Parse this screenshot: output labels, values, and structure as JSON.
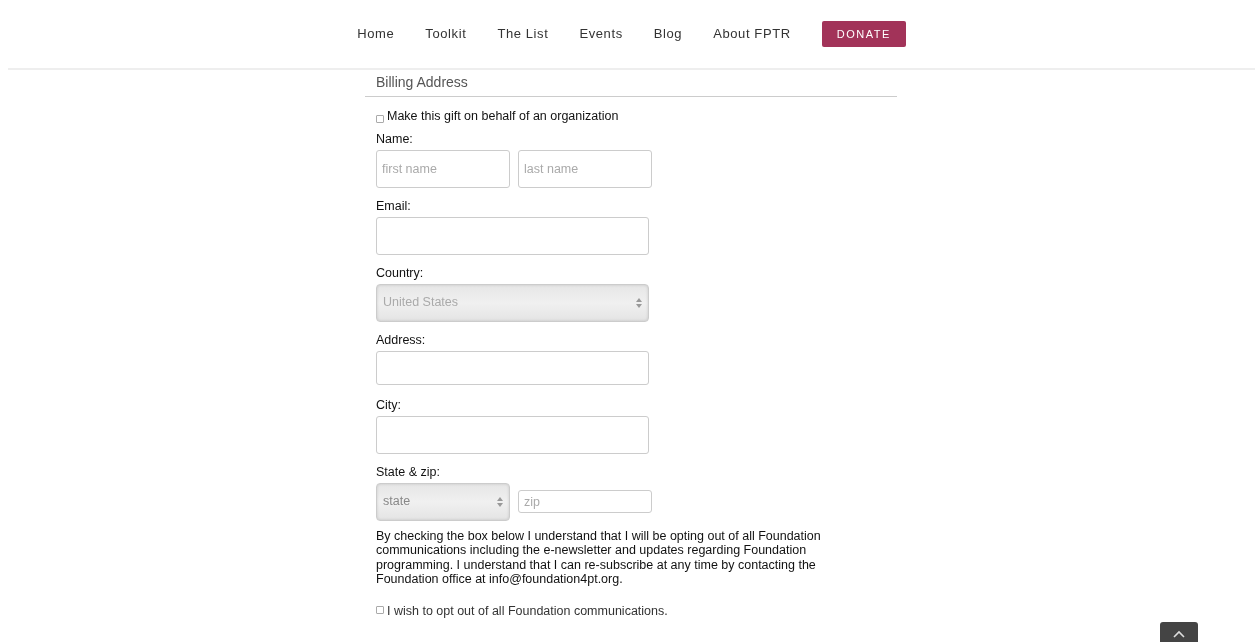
{
  "nav": {
    "items": [
      {
        "label": "Home"
      },
      {
        "label": "Toolkit"
      },
      {
        "label": "The List"
      },
      {
        "label": "Events"
      },
      {
        "label": "Blog"
      },
      {
        "label": "About FPTR"
      }
    ],
    "donate": "DONATE"
  },
  "billing": {
    "heading": "Billing Address",
    "org_checkbox": {
      "label": "Make this gift on behalf of an organization",
      "checked": false
    },
    "fields": [
      {
        "kind": "pair",
        "label": "Name:",
        "inputs": [
          {
            "placeholder": "first name"
          },
          {
            "placeholder": "last name"
          }
        ]
      },
      {
        "kind": "text",
        "label": "Email:"
      },
      {
        "kind": "select",
        "label": "Country:",
        "value": "United States"
      },
      {
        "kind": "text",
        "label": "Address:"
      },
      {
        "kind": "text",
        "label": "City:"
      },
      {
        "kind": "statezip",
        "label": "State & zip:",
        "select": "state",
        "placeholder": "zip"
      }
    ],
    "notice": "By checking the box below I understand that I will be opting out of all Foundation communications including the e-newsletter and updates regarding Foundation programming. I understand that I can re-subscribe at any time by contacting the Foundation office at info@foundation4pt.org.",
    "optout": {
      "label": "I wish to opt out of all Foundation communications.",
      "checked": false
    }
  }
}
